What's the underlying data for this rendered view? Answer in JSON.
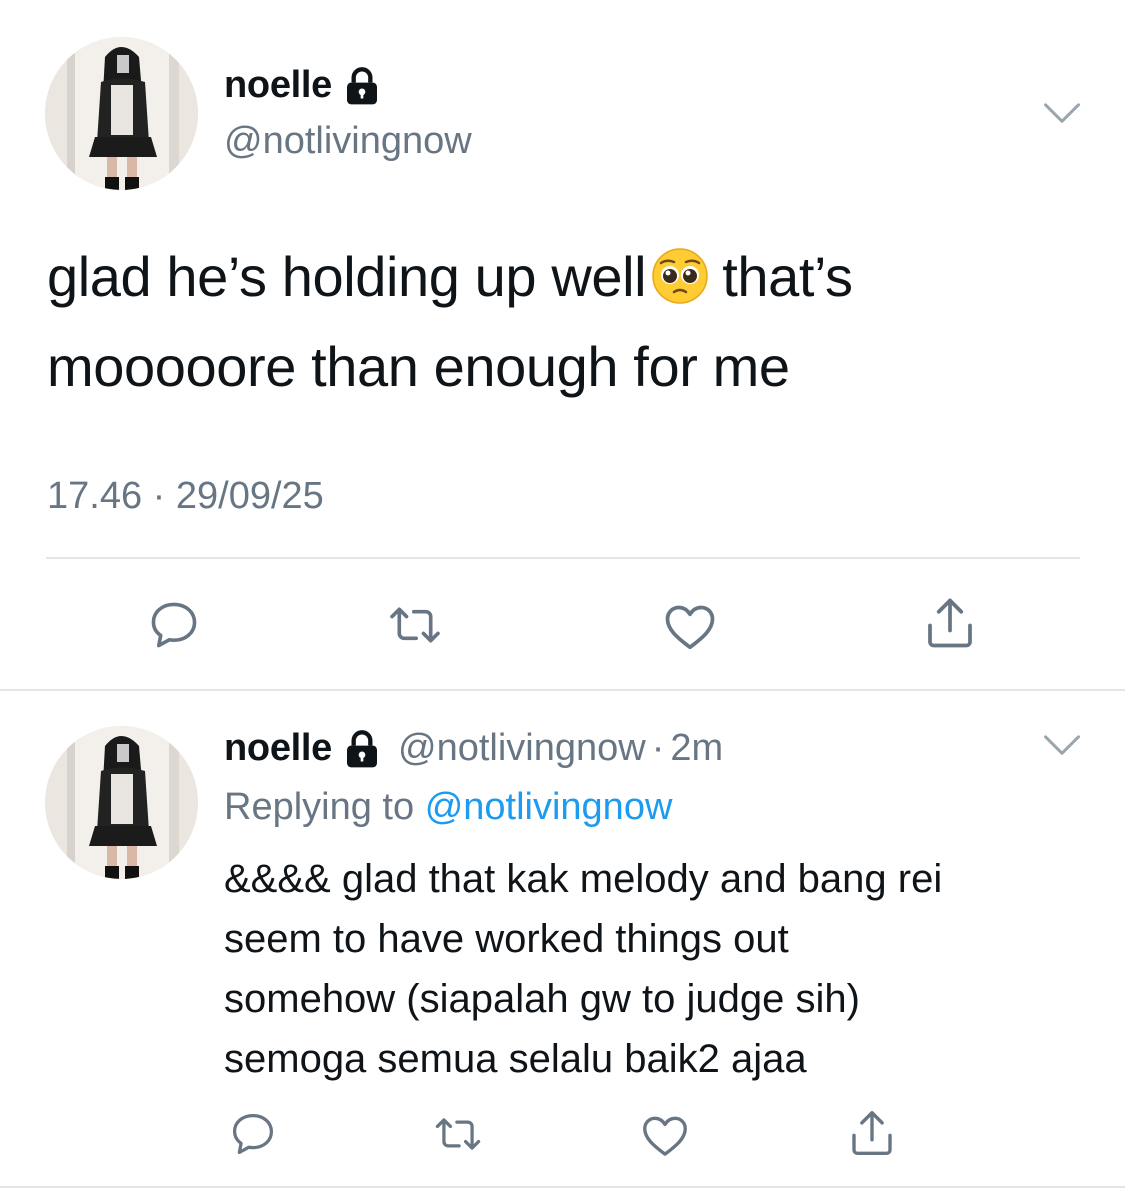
{
  "main_tweet": {
    "author_name": "noelle",
    "author_handle": "@notlivingnow",
    "text_line1_a": "glad he’s holding up well",
    "text_line1_b": "that’s",
    "text_line2": "mooooore than enough for me",
    "emoji_icon": "pleading-face-emoji",
    "timestamp": "17.46 · 29/09/25"
  },
  "reply_tweet": {
    "author_name": "noelle",
    "author_handle": "@notlivingnow",
    "time_sep": "·",
    "relative_time": "2m",
    "replying_prefix": "Replying to",
    "replying_handle": "@notlivingnow",
    "text_lines": [
      "&&&& glad that kak melody and bang rei",
      "seem to have worked things out",
      "somehow (siapalah gw to judge sih)",
      "semoga semua selalu baik2 ajaa"
    ]
  },
  "icons": {
    "lock": "lock-icon",
    "chevron": "chevron-down-icon",
    "reply": "reply-icon",
    "retweet": "retweet-icon",
    "like": "heart-icon",
    "share": "share-icon"
  },
  "colors": {
    "text": "#0f1419",
    "secondary": "#687684",
    "link": "#1d9bf0",
    "divider": "#e1e6ea"
  }
}
